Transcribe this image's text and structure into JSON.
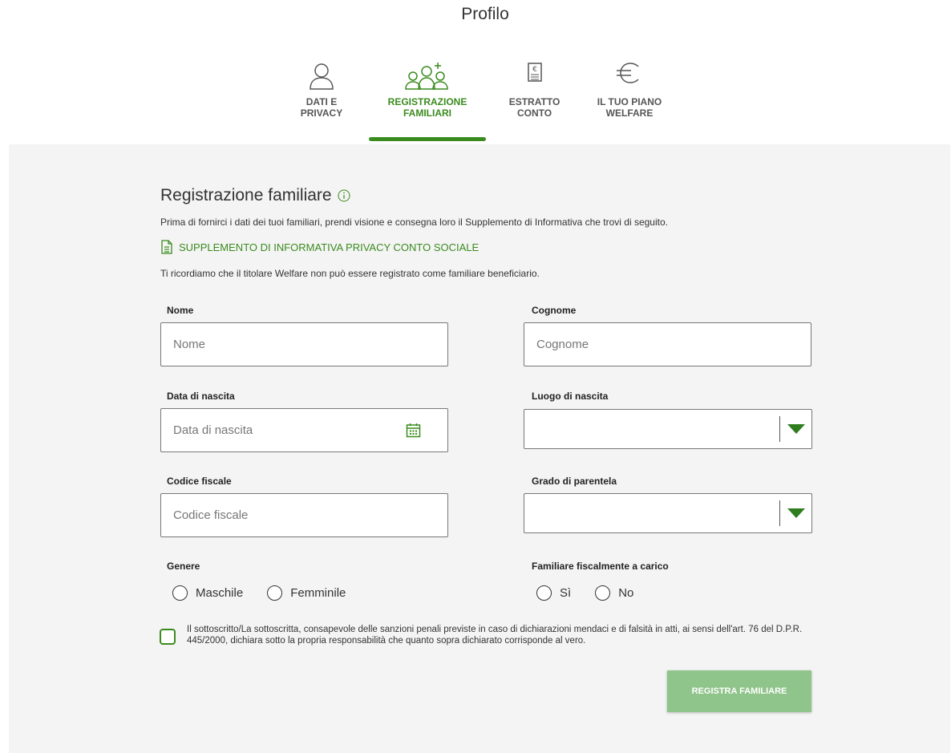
{
  "header": {
    "title": "Profilo"
  },
  "tabs": [
    {
      "label": "DATI E\nPRIVACY",
      "icon": "user-icon",
      "active": false
    },
    {
      "label": "REGISTRAZIONE\nFAMILIARI",
      "icon": "family-add-icon",
      "active": true
    },
    {
      "label": "ESTRATTO\nCONTO",
      "icon": "statement-icon",
      "active": false
    },
    {
      "label": "IL TUO PIANO\nWELFARE",
      "icon": "euro-icon",
      "active": false
    }
  ],
  "section": {
    "title": "Registrazione familiare",
    "intro": "Prima di fornirci i dati dei tuoi familiari, prendi visione e consegna loro il Supplemento di Informativa che trovi di seguito.",
    "doc_link": "SUPPLEMENTO DI INFORMATIVA PRIVACY CONTO SOCIALE",
    "note": "Ti ricordiamo che il titolare Welfare non può essere registrato come familiare beneficiario."
  },
  "form": {
    "nome": {
      "label": "Nome",
      "placeholder": "Nome",
      "value": ""
    },
    "cognome": {
      "label": "Cognome",
      "placeholder": "Cognome",
      "value": ""
    },
    "data_nascita": {
      "label": "Data di nascita",
      "placeholder": "Data di nascita",
      "value": ""
    },
    "luogo_nascita": {
      "label": "Luogo di nascita",
      "value": ""
    },
    "codice_fiscale": {
      "label": "Codice fiscale",
      "placeholder": "Codice fiscale",
      "value": ""
    },
    "grado_parentela": {
      "label": "Grado di parentela",
      "value": ""
    },
    "genere": {
      "label": "Genere",
      "options": [
        "Maschile",
        "Femminile"
      ]
    },
    "a_carico": {
      "label": "Familiare fiscalmente a carico",
      "options": [
        "Sì",
        "No"
      ]
    },
    "declaration": "Il sottoscritto/La sottoscritta, consapevole delle sanzioni penali previste in caso di dichiarazioni mendaci e di falsità in atti, ai sensi dell'art. 76 del D.P.R. 445/2000, dichiara sotto la propria responsabilità che quanto sopra dichiarato corrisponde al vero.",
    "submit_label": "REGISTRA FAMILIARE"
  },
  "colors": {
    "accent": "#3a8b1e",
    "submit_bg": "#8fc48a",
    "panel_bg": "#f4f4f4"
  }
}
